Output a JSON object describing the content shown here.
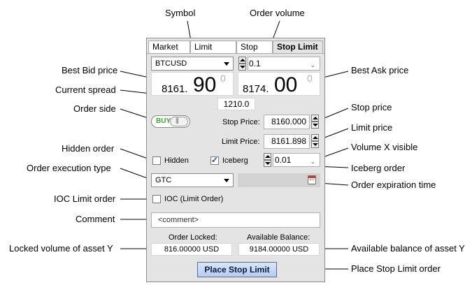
{
  "annotations": {
    "symbol": "Symbol",
    "order_volume": "Order volume",
    "best_bid": "Best Bid price",
    "best_ask": "Best Ask price",
    "current_spread": "Current spread",
    "order_side": "Order side",
    "stop_price": "Stop price",
    "limit_price": "Limit price",
    "hidden_order": "Hidden order",
    "volume_visible": "Volume X visible",
    "execution_type": "Order execution type",
    "iceberg_order": "Iceberg order",
    "expiration_time": "Order expiration time",
    "ioc_limit": "IOC Limit order",
    "comment": "Comment",
    "locked_volume": "Locked volume of asset Y",
    "available_balance": "Available balance of asset Y",
    "place_order": "Place Stop Limit order"
  },
  "tabs": [
    "Market",
    "Limit",
    "Stop",
    "Stop Limit"
  ],
  "active_tab": "Stop Limit",
  "symbol": "BTCUSD",
  "volume": "0.1",
  "bid": {
    "int": "8161.",
    "big": "90",
    "sup": "0"
  },
  "ask": {
    "int": "8174.",
    "big": "00",
    "sup": "0"
  },
  "spread": "1210.0",
  "side": "BUY",
  "stop_price_label": "Stop Price:",
  "stop_price": "8160.000",
  "limit_price_label": "Limit Price:",
  "limit_price": "8161.898",
  "hidden_label": "Hidden",
  "hidden_checked": false,
  "iceberg_label": "Iceberg",
  "iceberg_checked": true,
  "visible_volume": "0.01",
  "exec_type": "GTC",
  "ioc_label": "IOC (Limit Order)",
  "ioc_checked": false,
  "comment_placeholder": "<comment>",
  "locked_label": "Order Locked:",
  "locked_value": "816.00000 USD",
  "available_label": "Available Balance:",
  "available_value": "9184.00000 USD",
  "place_button": "Place Stop Limit",
  "icons": [
    "spin-icon",
    "chevron-down-icon",
    "toggle-knob-icon",
    "calendar-icon",
    "check-icon"
  ]
}
